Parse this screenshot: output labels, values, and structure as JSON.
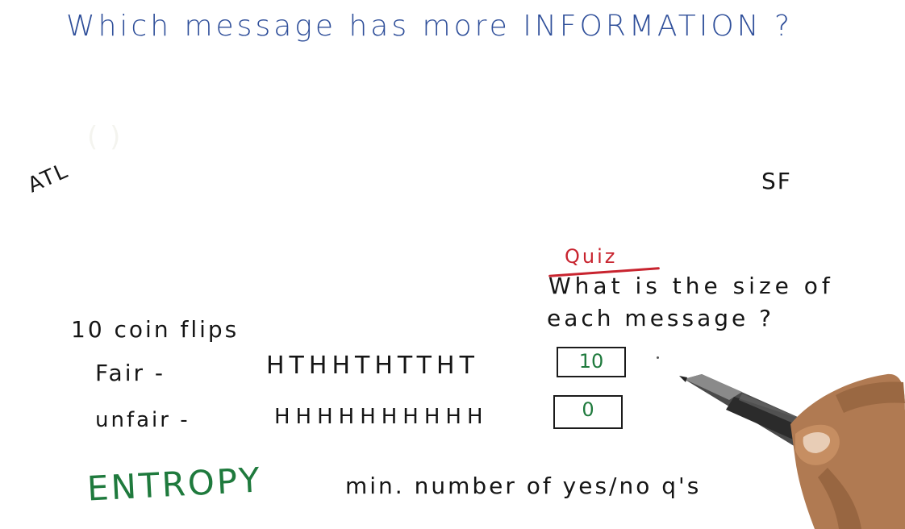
{
  "title": "Which message has more INFORMATION ?",
  "left_city": "ATL",
  "right_city": "SF",
  "ghost_text": "(  )",
  "quiz": {
    "label": "Quiz",
    "question_line1": "What is the size of",
    "question_line2": "each message ?"
  },
  "flips_heading": "10 coin flips",
  "rows": [
    {
      "label": "Fair -",
      "sequence": "HTHHTHTTHT",
      "answer": "10"
    },
    {
      "label": "unfair -",
      "sequence": "HHHHHHHHHH",
      "answer": "0"
    }
  ],
  "entropy": {
    "term": "ENTROPY",
    "definition": "min. number of yes/no q's"
  },
  "colors": {
    "blue_ink": "#2f4f9a",
    "black_ink": "#151515",
    "red_ink": "#c8242f",
    "green_ink": "#1f7a3d",
    "background": "#ffffff"
  },
  "icons": [
    "hand-holding-pen-icon"
  ]
}
